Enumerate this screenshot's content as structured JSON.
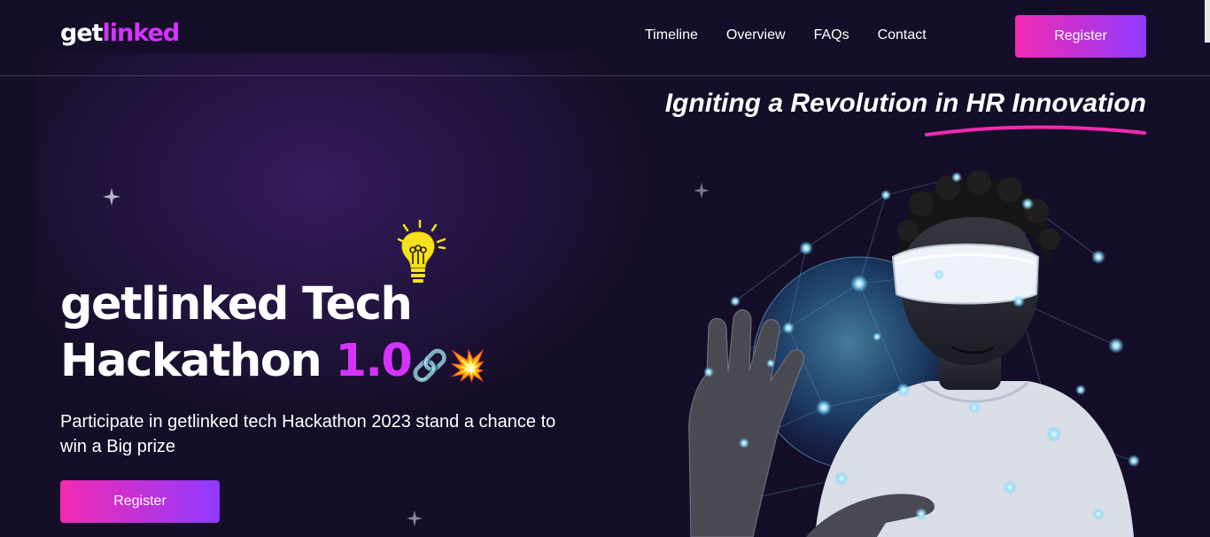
{
  "header": {
    "logo_part1": "get",
    "logo_part2": "linked",
    "nav": [
      "Timeline",
      "Overview",
      "FAQs",
      "Contact"
    ],
    "register_label": "Register"
  },
  "hero": {
    "tagline": "Igniting a Revolution in HR Innovation",
    "title_line1": "getlinked Tech",
    "title_line2_main": "Hackathon ",
    "title_line2_accent": "1.0",
    "link_emoji": "🔗",
    "boom_emoji": "💥",
    "subtitle": "Participate in getlinked tech Hackathon 2023 stand a chance to win a Big prize",
    "register_label": "Register"
  },
  "icons": {
    "bulb": "lightbulb-icon",
    "star": "sparkle-star-icon"
  },
  "colors": {
    "background": "#150e28",
    "accent": "#d434fe",
    "gradient_start": "#f22ab1",
    "gradient_end": "#903aff"
  }
}
